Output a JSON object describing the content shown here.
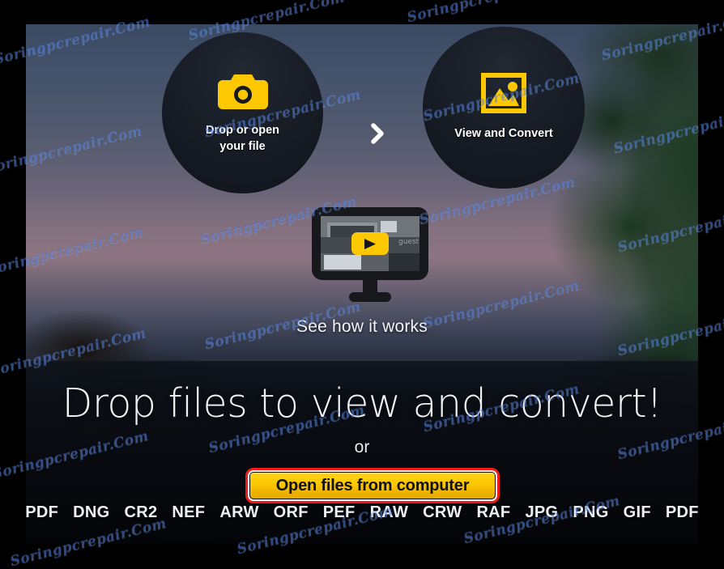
{
  "app": {
    "name": "online-raw-image-converter",
    "watermark_text": "Soringpcrepair.Com"
  },
  "hero": {
    "steps": [
      {
        "icon": "camera-icon",
        "label_line1": "Drop or open",
        "label_line2": "your file"
      },
      {
        "icon": "image-icon",
        "label": "View and Convert"
      }
    ],
    "separator_icon": "chevron-right-icon",
    "video": {
      "icon": "monitor-play-icon",
      "play_icon": "play-triangle-icon",
      "caption": "See how it works",
      "thumbnail_label": "guest"
    }
  },
  "dropzone": {
    "headline": "Drop files to view and convert!",
    "or_label": "or",
    "open_button_label": "Open files from computer",
    "formats": [
      "PDF",
      "DNG",
      "CR2",
      "NEF",
      "ARW",
      "ORF",
      "PEF",
      "RAW",
      "CRW",
      "RAF",
      "JPG",
      "PNG",
      "GIF",
      "PDF"
    ]
  },
  "colors": {
    "accent_yellow": "#fdc800",
    "annotation_red": "#ee1b1b",
    "circle_dark": "#181d26",
    "text_light": "#f0f2f5"
  }
}
